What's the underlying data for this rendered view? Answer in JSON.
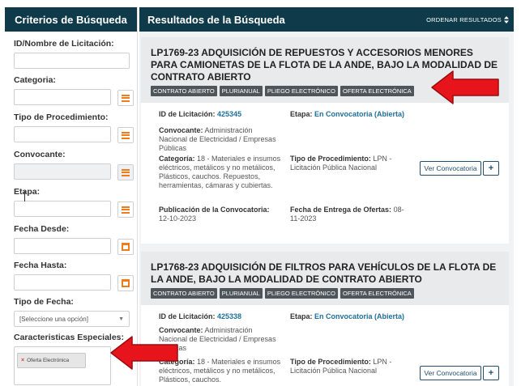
{
  "filters": {
    "title": "Criterios de Búsqueda",
    "id_label": "ID/Nombre de Licitación:",
    "categoria_label": "Categoria:",
    "tipo_proc_label": "Tipo de Procedimiento:",
    "convocante_label": "Convocante:",
    "etapa_label": "Etapa:",
    "fecha_desde_label": "Fecha Desde:",
    "fecha_hasta_label": "Fecha Hasta:",
    "tipo_fecha_label": "Tipo de Fecha:",
    "tipo_fecha_value": "[Seleccione una opción]",
    "caracteristicas_label": "Caracteristicas Especiales:",
    "caracteristicas_tag": "Oferta Electrónica"
  },
  "results": {
    "title": "Resultados de la Búsqueda",
    "sort_label": "ORDENAR RESULTADOS",
    "sort_icon": "sort-icon",
    "items": [
      {
        "title": "LP1769-23 ADQUISICIÓN DE REPUESTOS Y ACCESORIOS MENORES PARA CAMIONETAS DE LA FLOTA DE LA ANDE, BAJO LA MODALIDAD DE CONTRATO ABIERTO",
        "badges": [
          "CONTRATO ABIERTO",
          "PLURIANUAL",
          "PLIEGO ELECTRÓNICO",
          "OFERTA ELECTRÓNICA"
        ],
        "id_label": "ID de Licitación:",
        "id_value": "425345",
        "etapa_label": "Etapa:",
        "etapa_value": "En Convocatoria (Abierta)",
        "convocante_label": "Convocante:",
        "convocante_value": "Administración Nacional de Electricidad / Empresas Públicas",
        "categoria_label": "Categoría:",
        "categoria_value": "18 - Materiales e insumos eléctricos, metálicos y no metálicos, Plásticos, cauchos. Repuestos, herramientas, cámaras y cubiertas.",
        "tipo_label": "Tipo de Procedimiento:",
        "tipo_value": "LPN - Licitación Pública Nacional",
        "publicacion_label": "Publicación de la Convocatoria:",
        "publicacion_value": "12-10-2023",
        "entrega_label": "Fecha de Entrega de Ofertas:",
        "entrega_value": "08-11-2023",
        "ver_label": "Ver Convocatoria",
        "plus_label": "+"
      },
      {
        "title": "LP1768-23 ADQUISICIÓN DE FILTROS PARA VEHÍCULOS DE LA FLOTA DE LA ANDE, BAJO LA MODALIDAD DE CONTRATO ABIERTO",
        "badges": [
          "CONTRATO ABIERTO",
          "PLURIANUAL",
          "PLIEGO ELECTRÓNICO",
          "OFERTA ELECTRÓNICA"
        ],
        "id_label": "ID de Licitación:",
        "id_value": "425338",
        "etapa_label": "Etapa:",
        "etapa_value": "En Convocatoria (Abierta)",
        "convocante_label": "Convocante:",
        "convocante_value": "Administración Nacional de Electricidad / Empresas Públicas",
        "categoria_label": "Categoría:",
        "categoria_value": "18 - Materiales e insumos eléctricos, metálicos y no metálicos, Plásticos, cauchos.",
        "tipo_label": "Tipo de Procedimiento:",
        "tipo_value": "LPN - Licitación Pública Nacional",
        "ver_label": "Ver Convocatoria",
        "plus_label": "+"
      }
    ]
  },
  "colors": {
    "header_bg": "#0e3a4a",
    "accent_orange": "#f07b1a",
    "link_blue": "#1f6f9b",
    "badge_bg": "#4e555b",
    "arrow_red": "#e8141c"
  }
}
